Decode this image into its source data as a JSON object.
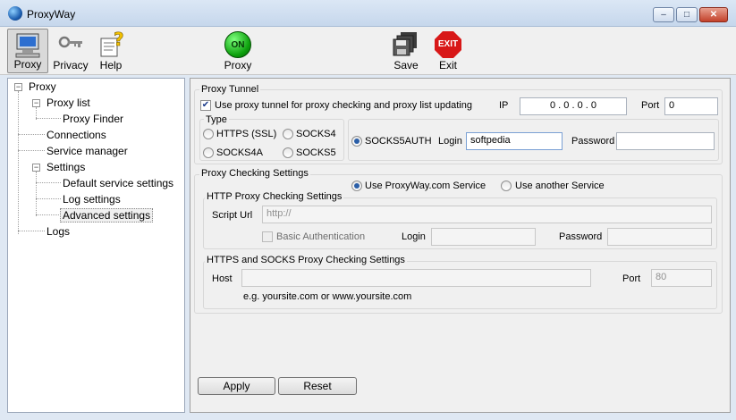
{
  "window": {
    "title": "ProxyWay",
    "min": "–",
    "max": "□",
    "close": "✕"
  },
  "toolbar": {
    "proxy": "Proxy",
    "privacy": "Privacy",
    "help": "Help",
    "proxy_toggle": "Proxy",
    "on_text": "ON",
    "save": "Save",
    "exit": "Exit",
    "exit_text": "EXIT"
  },
  "tree": {
    "proxy": "Proxy",
    "proxy_list": "Proxy list",
    "proxy_finder": "Proxy Finder",
    "connections": "Connections",
    "service_manager": "Service manager",
    "settings": "Settings",
    "default_service": "Default service settings",
    "log_settings": "Log settings",
    "advanced": "Advanced settings",
    "logs": "Logs"
  },
  "tunnel": {
    "group": "Proxy Tunnel",
    "use_label": "Use proxy tunnel for proxy checking and proxy list updating",
    "ip_label": "IP",
    "ip_value": "0  .  0  .  0  .  0",
    "port_label": "Port",
    "port_value": "0",
    "type_label": "Type",
    "https": "HTTPS (SSL)",
    "socks4": "SOCKS4",
    "socks4a": "SOCKS4A",
    "socks5": "SOCKS5",
    "socks5auth": "SOCKS5AUTH",
    "login_label": "Login",
    "login_value": "softpedia",
    "password_label": "Password",
    "password_value": ""
  },
  "checking": {
    "group": "Proxy Checking Settings",
    "use_proxyway": "Use ProxyWay.com Service",
    "use_another": "Use another Service",
    "http_group": "HTTP Proxy Checking Settings",
    "script_url_label": "Script Url",
    "script_url_value": "http://",
    "basic_auth": "Basic Authentication",
    "login_label": "Login",
    "password_label": "Password",
    "https_group": "HTTPS and SOCKS Proxy Checking Settings",
    "host_label": "Host",
    "host_value": "",
    "port_label": "Port",
    "port_value": "80",
    "example": "e.g. yoursite.com or www.yoursite.com"
  },
  "buttons": {
    "apply": "Apply",
    "reset": "Reset"
  }
}
